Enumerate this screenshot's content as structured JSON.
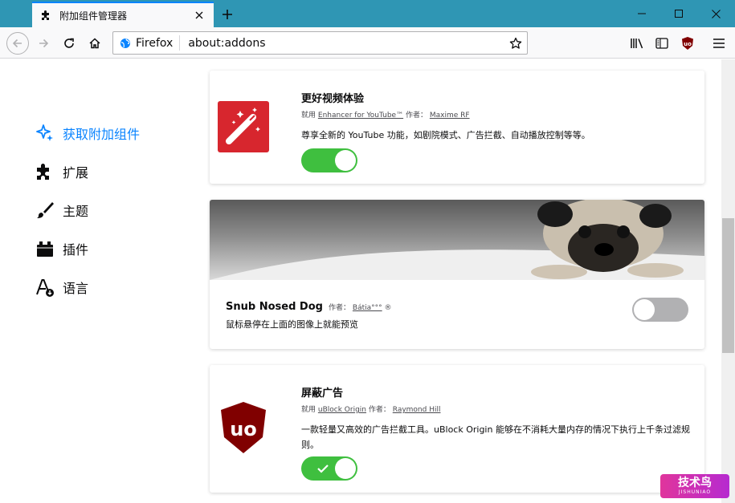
{
  "tab": {
    "title": "附加组件管理器"
  },
  "urlbar": {
    "identity_label": "Firefox",
    "url": "about:addons"
  },
  "categories": [
    {
      "label": "获取附加组件",
      "icon": "sparkle-icon",
      "selected": true
    },
    {
      "label": "扩展",
      "icon": "puzzle-icon",
      "selected": false
    },
    {
      "label": "主题",
      "icon": "brush-icon",
      "selected": false
    },
    {
      "label": "插件",
      "icon": "plugin-icon",
      "selected": false
    },
    {
      "label": "语言",
      "icon": "language-icon",
      "selected": false
    }
  ],
  "addons": [
    {
      "name": "更好视频体验",
      "meta_prefix": "就用",
      "meta_link": "Enhancer for YouTube™",
      "meta_author_label": "作者：",
      "meta_author": "Maxime RF",
      "description": "尊享全新的 YouTube 功能，如剧院模式、广告拦截、自动播放控制等等。",
      "enabled": true
    },
    {
      "name": "Snub Nosed Dog",
      "meta_author_label": "作者：",
      "meta_author": "Bátia°°°",
      "description": "鼠标悬停在上面的图像上就能预览",
      "enabled": false
    },
    {
      "name": "屏蔽广告",
      "meta_prefix": "就用",
      "meta_link": "uBlock Origin",
      "meta_author_label": "作者：",
      "meta_author": "Raymond Hill",
      "description": "一款轻量又高效的广告拦截工具。uBlock Origin 能够在不消耗大量内存的情况下执行上千条过滤规则。",
      "enabled": true
    }
  ],
  "watermark": {
    "main": "技术鸟",
    "sub": "JISHUNIAO"
  },
  "colors": {
    "titlebar": "#2f96b4",
    "accent": "#0a84ff",
    "toggle_on": "#3fbf3f",
    "toggle_off": "#b1b1b3"
  }
}
